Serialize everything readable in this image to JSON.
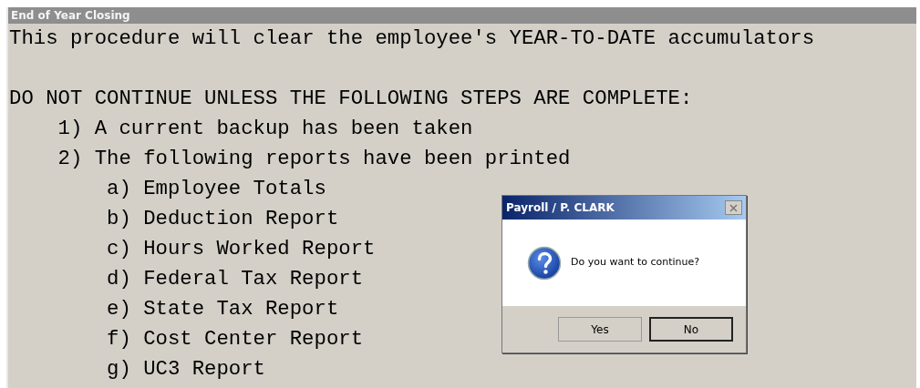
{
  "window": {
    "title": "End of Year Closing"
  },
  "intro": "This procedure will clear the employee's YEAR-TO-DATE accumulators",
  "warning": "DO NOT CONTINUE UNLESS THE FOLLOWING STEPS ARE COMPLETE:",
  "steps": [
    {
      "label": "1) A current backup has been taken"
    },
    {
      "label": "2) The following reports have been printed",
      "children": [
        {
          "label": "a) Employee Totals"
        },
        {
          "label": "b) Deduction Report"
        },
        {
          "label": "c) Hours Worked Report"
        },
        {
          "label": "d) Federal Tax Report"
        },
        {
          "label": "e) State Tax Report"
        },
        {
          "label": "f) Cost Center Report"
        },
        {
          "label": "g) UC3 Report"
        }
      ]
    }
  ],
  "dialog": {
    "title": "Payroll / P. CLARK",
    "message": "Do you want to continue?",
    "buttons": [
      {
        "label": "Yes",
        "default": false
      },
      {
        "label": "No",
        "default": true
      }
    ]
  }
}
